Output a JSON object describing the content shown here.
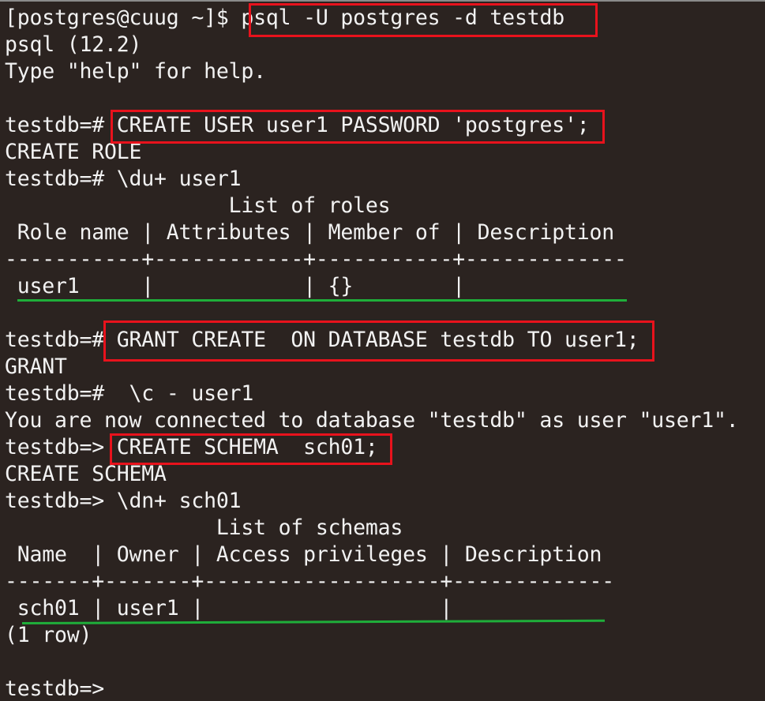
{
  "terminal": {
    "lines": [
      {
        "prompt": "[postgres@cuug ~]$ ",
        "text": "psql -U postgres -d testdb"
      },
      {
        "prompt": "",
        "text": "psql (12.2)"
      },
      {
        "prompt": "",
        "text": "Type \"help\" for help."
      },
      {
        "prompt": "",
        "text": ""
      },
      {
        "prompt": "testdb=# ",
        "text": "CREATE USER user1 PASSWORD 'postgres';"
      },
      {
        "prompt": "",
        "text": "CREATE ROLE"
      },
      {
        "prompt": "testdb=# ",
        "text": "\\du+ user1"
      },
      {
        "prompt": "",
        "text": "                  List of roles"
      },
      {
        "prompt": "",
        "text": " Role name | Attributes | Member of | Description"
      },
      {
        "prompt": "",
        "text": "-----------+------------+-----------+-------------"
      },
      {
        "prompt": "",
        "text": " user1     |            | {}        |"
      },
      {
        "prompt": "",
        "text": ""
      },
      {
        "prompt": "testdb=# ",
        "text": "GRANT CREATE  ON DATABASE testdb TO user1;"
      },
      {
        "prompt": "",
        "text": "GRANT"
      },
      {
        "prompt": "testdb=# ",
        "text": " \\c - user1"
      },
      {
        "prompt": "",
        "text": "You are now connected to database \"testdb\" as user \"user1\"."
      },
      {
        "prompt": "testdb=> ",
        "text": "CREATE SCHEMA  sch01;"
      },
      {
        "prompt": "",
        "text": "CREATE SCHEMA"
      },
      {
        "prompt": "testdb=> ",
        "text": "\\dn+ sch01"
      },
      {
        "prompt": "",
        "text": "                 List of schemas"
      },
      {
        "prompt": "",
        "text": " Name  | Owner | Access privileges | Description"
      },
      {
        "prompt": "",
        "text": "-------+-------+-------------------+-------------"
      },
      {
        "prompt": "",
        "text": " sch01 | user1 |                   |"
      },
      {
        "prompt": "",
        "text": "(1 row)"
      },
      {
        "prompt": "",
        "text": ""
      },
      {
        "prompt": "testdb=> ",
        "text": ""
      }
    ]
  },
  "colors": {
    "background": "#2b2320",
    "text": "#f2f2f2",
    "highlight_box": "#e8121c",
    "underline": "#1fae3a"
  }
}
